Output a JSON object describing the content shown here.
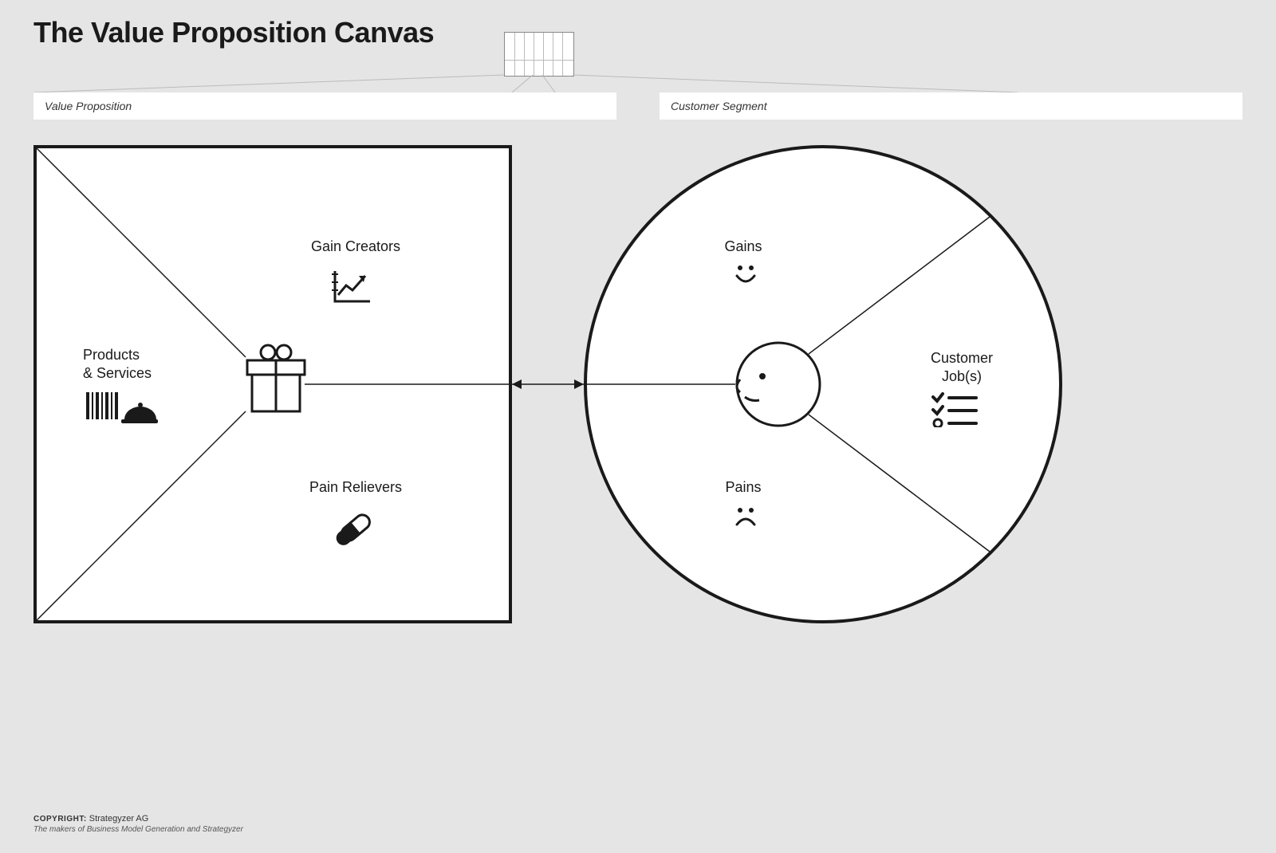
{
  "title": "The Value Proposition Canvas",
  "header": {
    "left": "Value Proposition",
    "right": "Customer Segment"
  },
  "square": {
    "gain_creators": "Gain Creators",
    "products_services": "Products\n& Services",
    "pain_relievers": "Pain Relievers"
  },
  "circle": {
    "gains": "Gains",
    "pains": "Pains",
    "customer_jobs": "Customer\nJob(s)"
  },
  "footer": {
    "copyright_label": "copyright:",
    "org": "Strategyzer AG",
    "subline": "The makers of Business Model Generation and Strategyzer"
  },
  "icons": {
    "gift": "gift-icon",
    "chart": "chart-up-icon",
    "pill": "pill-icon",
    "barcode_cloche": "barcode-cloche-icon",
    "smile": "smile-icon",
    "frown": "frown-icon",
    "face_profile": "face-profile-icon",
    "checklist": "checklist-icon"
  }
}
